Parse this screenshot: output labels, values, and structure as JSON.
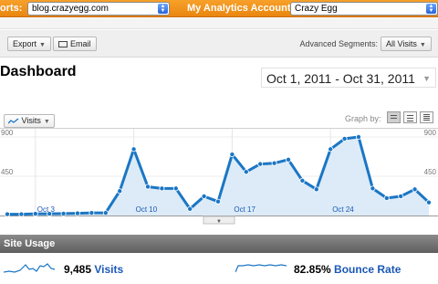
{
  "topbar": {
    "reports_label": "orts:",
    "site_value": "blog.crazyegg.com",
    "accounts_label": "My Analytics Accounts:",
    "account_value": "Crazy Egg"
  },
  "toolbar": {
    "export_label": "Export",
    "email_label": "Email",
    "advanced_segments_label": "Advanced Segments:",
    "segment_value": "All Visits"
  },
  "page": {
    "title": "Dashboard",
    "date_range": "Oct 1, 2011 - Oct 31, 2011"
  },
  "graph": {
    "metric_selector": "Visits",
    "graph_by_label": "Graph by:",
    "view_options": [
      "day",
      "week",
      "month"
    ],
    "active_view": "day"
  },
  "chart_data": {
    "type": "line",
    "ylim": [
      0,
      900
    ],
    "y_ticks": [
      "900",
      "450"
    ],
    "x_tick_labels": [
      "Oct 3",
      "Oct 10",
      "Oct 17",
      "Oct 24"
    ],
    "x_tick_days": [
      3,
      10,
      17,
      24
    ],
    "days": [
      1,
      2,
      3,
      4,
      5,
      6,
      7,
      8,
      9,
      10,
      11,
      12,
      13,
      14,
      15,
      16,
      17,
      18,
      19,
      20,
      21,
      22,
      23,
      24,
      25,
      26,
      27,
      28,
      29,
      30,
      31
    ],
    "series": [
      {
        "color": "#1b76c4",
        "fill": "#dcebf7",
        "values": [
          15,
          15,
          20,
          20,
          22,
          25,
          30,
          30,
          280,
          760,
          330,
          310,
          310,
          75,
          220,
          160,
          700,
          500,
          590,
          600,
          640,
          400,
          300,
          760,
          880,
          900,
          310,
          200,
          220,
          300,
          150
        ]
      }
    ]
  },
  "site_usage": {
    "header": "Site Usage",
    "stats": [
      {
        "value": "9,485",
        "label": "Visits"
      },
      {
        "value": "82.85%",
        "label": "Bounce Rate"
      }
    ]
  }
}
